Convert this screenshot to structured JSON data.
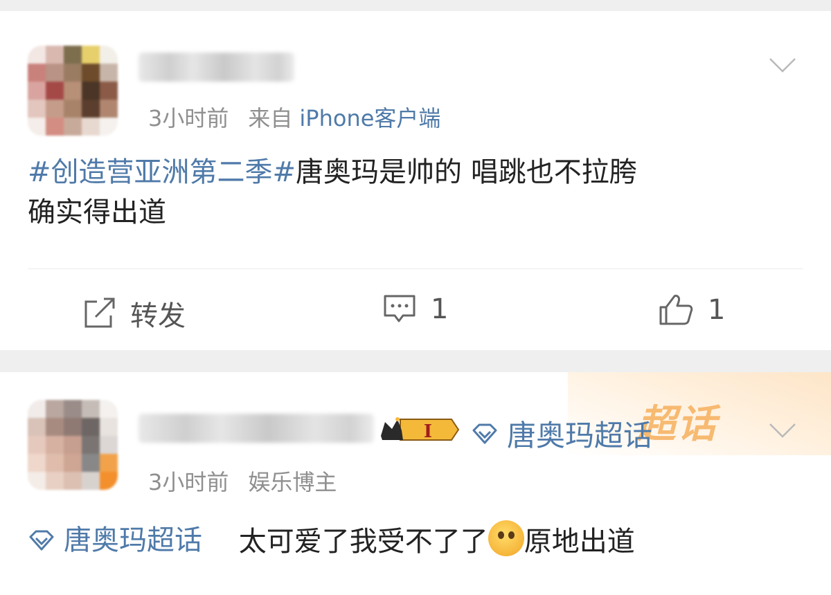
{
  "posts": [
    {
      "time": "3小时前",
      "source_prefix": "来自",
      "source_client": "iPhone客户端",
      "text_topic": "#创造营亚洲第二季#",
      "text_body": "唐奥玛是帅的 唱跳也不拉胯",
      "text_line2": "确实得出道",
      "actions": {
        "repost_label": "转发",
        "comment_count": "1",
        "like_count": "1"
      }
    },
    {
      "time": "3小时前",
      "role": "娱乐博主",
      "badge_level": "I",
      "super_topic": "唐奥玛超话",
      "watermark": "超话",
      "text_topic": "唐奥玛超话",
      "text_body": "太可爱了我受不了了",
      "text_tail": "原地出道"
    }
  ],
  "icons": [
    "chevron-down-icon",
    "repost-icon",
    "comment-icon",
    "like-icon",
    "supertopic-diamond-icon",
    "crown-badge-icon",
    "pleading-emoji-icon"
  ],
  "colors": {
    "link_blue": "#4f7aa9",
    "meta_gray": "#8f8f8f",
    "badge_gold": "#f5b93a",
    "banner_orange": "#f6b05d"
  }
}
